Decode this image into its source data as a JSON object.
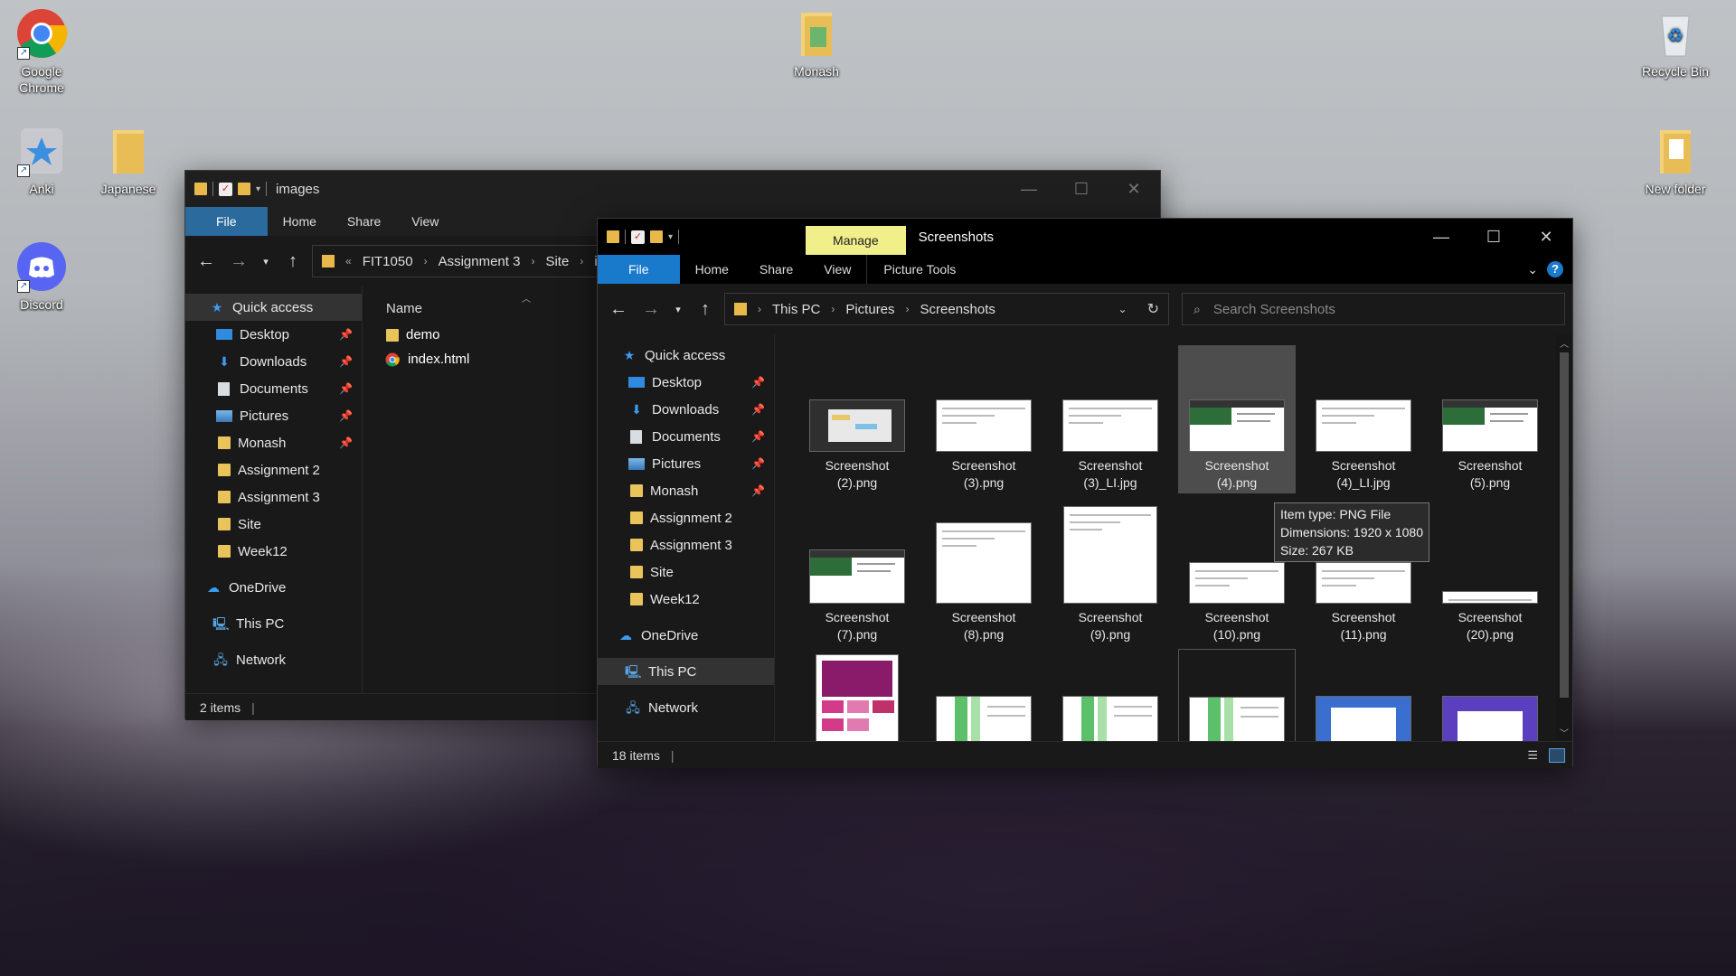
{
  "desktop": {
    "icons": [
      {
        "label": "Google\nChrome",
        "icon": "chrome-icon"
      },
      {
        "label": "Anki",
        "icon": "anki-icon"
      },
      {
        "label": "Japanese",
        "icon": "folder-icon"
      },
      {
        "label": "Discord",
        "icon": "discord-icon"
      },
      {
        "label": "Monash",
        "icon": "folder-icon"
      },
      {
        "label": "Recycle Bin",
        "icon": "recycle-bin-icon"
      },
      {
        "label": "New folder",
        "icon": "folder-icon"
      }
    ]
  },
  "win_images": {
    "title": "images",
    "tabs": [
      "File",
      "Home",
      "Share",
      "View"
    ],
    "address": [
      "FIT1050",
      "Assignment 3",
      "Site",
      "imag"
    ],
    "column_header": "Name",
    "nav": [
      {
        "label": "Quick access",
        "icon": "star-icon"
      },
      {
        "label": "Desktop",
        "icon": "desktop-icon",
        "pinned": true
      },
      {
        "label": "Downloads",
        "icon": "download-icon",
        "pinned": true
      },
      {
        "label": "Documents",
        "icon": "documents-icon",
        "pinned": true
      },
      {
        "label": "Pictures",
        "icon": "pictures-icon",
        "pinned": true
      },
      {
        "label": "Monash",
        "icon": "folder-icon",
        "pinned": true
      },
      {
        "label": "Assignment 2",
        "icon": "folder-icon"
      },
      {
        "label": "Assignment 3",
        "icon": "folder-icon"
      },
      {
        "label": "Site",
        "icon": "folder-icon"
      },
      {
        "label": "Week12",
        "icon": "folder-icon"
      },
      {
        "label": "OneDrive",
        "icon": "onedrive-icon"
      },
      {
        "label": "This PC",
        "icon": "this-pc-icon"
      },
      {
        "label": "Network",
        "icon": "network-icon"
      }
    ],
    "files": [
      {
        "name": "demo",
        "icon": "folder-icon"
      },
      {
        "name": "index.html",
        "icon": "chrome-icon"
      }
    ],
    "status": "2 items"
  },
  "win_screens": {
    "title": "Screenshots",
    "manage_tab": "Manage",
    "picture_tools_tab": "Picture Tools",
    "tabs": [
      "File",
      "Home",
      "Share",
      "View"
    ],
    "address": [
      "This PC",
      "Pictures",
      "Screenshots"
    ],
    "search_placeholder": "Search Screenshots",
    "nav": [
      {
        "label": "Quick access",
        "icon": "star-icon"
      },
      {
        "label": "Desktop",
        "icon": "desktop-icon",
        "pinned": true
      },
      {
        "label": "Downloads",
        "icon": "download-icon",
        "pinned": true
      },
      {
        "label": "Documents",
        "icon": "documents-icon",
        "pinned": true
      },
      {
        "label": "Pictures",
        "icon": "pictures-icon",
        "pinned": true
      },
      {
        "label": "Monash",
        "icon": "folder-icon",
        "pinned": true
      },
      {
        "label": "Assignment 2",
        "icon": "folder-icon"
      },
      {
        "label": "Assignment 3",
        "icon": "folder-icon"
      },
      {
        "label": "Site",
        "icon": "folder-icon"
      },
      {
        "label": "Week12",
        "icon": "folder-icon"
      },
      {
        "label": "OneDrive",
        "icon": "onedrive-icon"
      },
      {
        "label": "This PC",
        "icon": "this-pc-icon"
      },
      {
        "label": "Network",
        "icon": "network-icon"
      }
    ],
    "files": [
      {
        "l1": "Screenshot",
        "l2": "(2).png"
      },
      {
        "l1": "Screenshot",
        "l2": "(3).png"
      },
      {
        "l1": "Screenshot",
        "l2": "(3)_LI.jpg"
      },
      {
        "l1": "Screenshot",
        "l2": "(4).png"
      },
      {
        "l1": "Screenshot",
        "l2": "(4)_LI.jpg"
      },
      {
        "l1": "Screenshot",
        "l2": "(5).png"
      },
      {
        "l1": "Screenshot",
        "l2": "(7).png"
      },
      {
        "l1": "Screenshot",
        "l2": "(8).png"
      },
      {
        "l1": "Screenshot",
        "l2": "(9).png"
      },
      {
        "l1": "Screenshot",
        "l2": "(10).png"
      },
      {
        "l1": "Screenshot",
        "l2": "(11).png"
      },
      {
        "l1": "Screenshot",
        "l2": "(20).png"
      }
    ],
    "tooltip": {
      "line1": "Item type: PNG File",
      "line2": "Dimensions: 1920 x 1080",
      "line3": "Size: 267 KB"
    },
    "status": "18 items"
  }
}
